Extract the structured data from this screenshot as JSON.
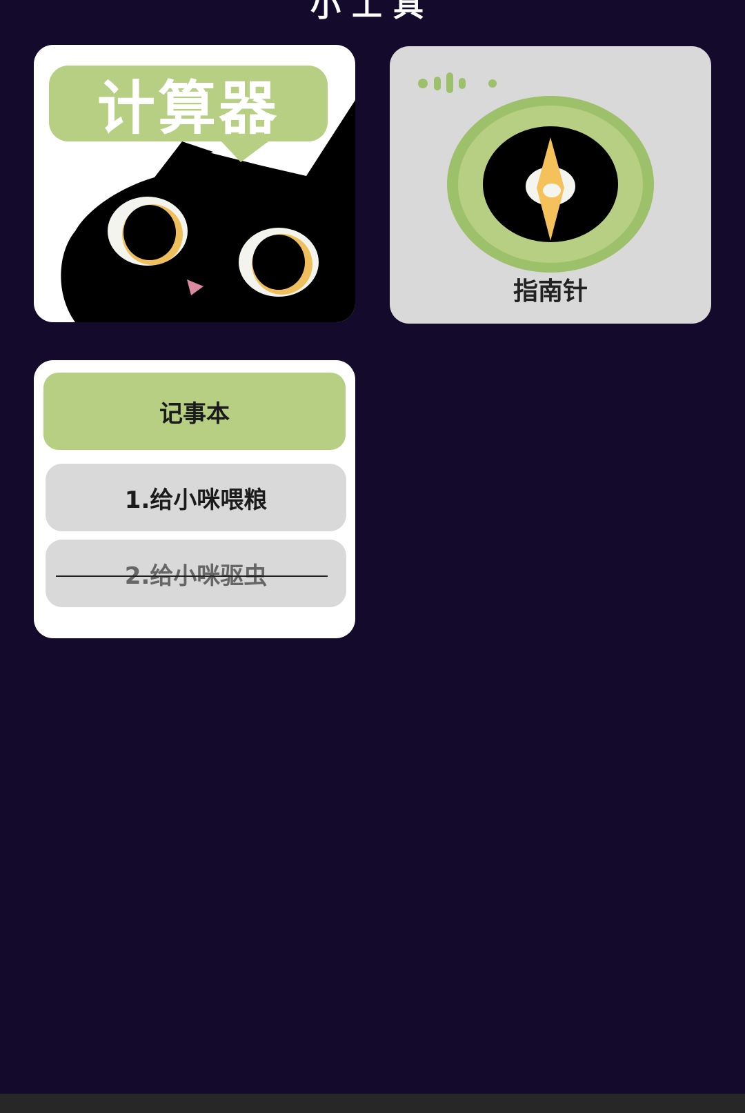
{
  "app": {
    "title": "小工具"
  },
  "tools": {
    "calculator": {
      "label": "计算器"
    },
    "compass": {
      "label": "指南针"
    },
    "notepad": {
      "label": "记事本",
      "items": [
        {
          "text": "1.给小咪喂粮",
          "done": false
        },
        {
          "text": "2.给小咪驱虫",
          "done": true
        }
      ]
    }
  },
  "colors": {
    "background": "#140a2b",
    "accent_green": "#b6cf83",
    "card_gray": "#d9d9d9",
    "needle_yellow": "#f5c15b"
  }
}
